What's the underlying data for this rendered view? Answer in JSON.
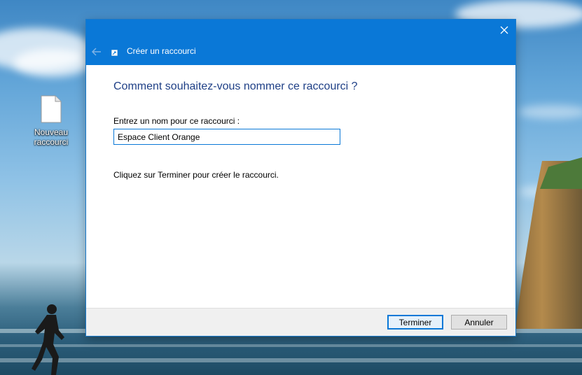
{
  "desktop": {
    "icons": [
      {
        "label_line1": "Nouveau",
        "label_line2": "raccourci",
        "icon": "blank-file-icon"
      }
    ]
  },
  "dialog": {
    "title": "Créer un raccourci",
    "back_icon": "back-arrow-icon",
    "title_icon": "shortcut-icon",
    "close_icon": "close-icon",
    "heading": "Comment souhaitez-vous nommer ce raccourci ?",
    "field_label": "Entrez un nom pour ce raccourci :",
    "name_value": "Espace Client Orange",
    "hint": "Cliquez sur Terminer pour créer le raccourci.",
    "finish_label": "Terminer",
    "cancel_label": "Annuler"
  },
  "colors": {
    "title_bar": "#0a78d7",
    "heading_text": "#1e3f86",
    "footer_bg": "#f0f0f0"
  }
}
